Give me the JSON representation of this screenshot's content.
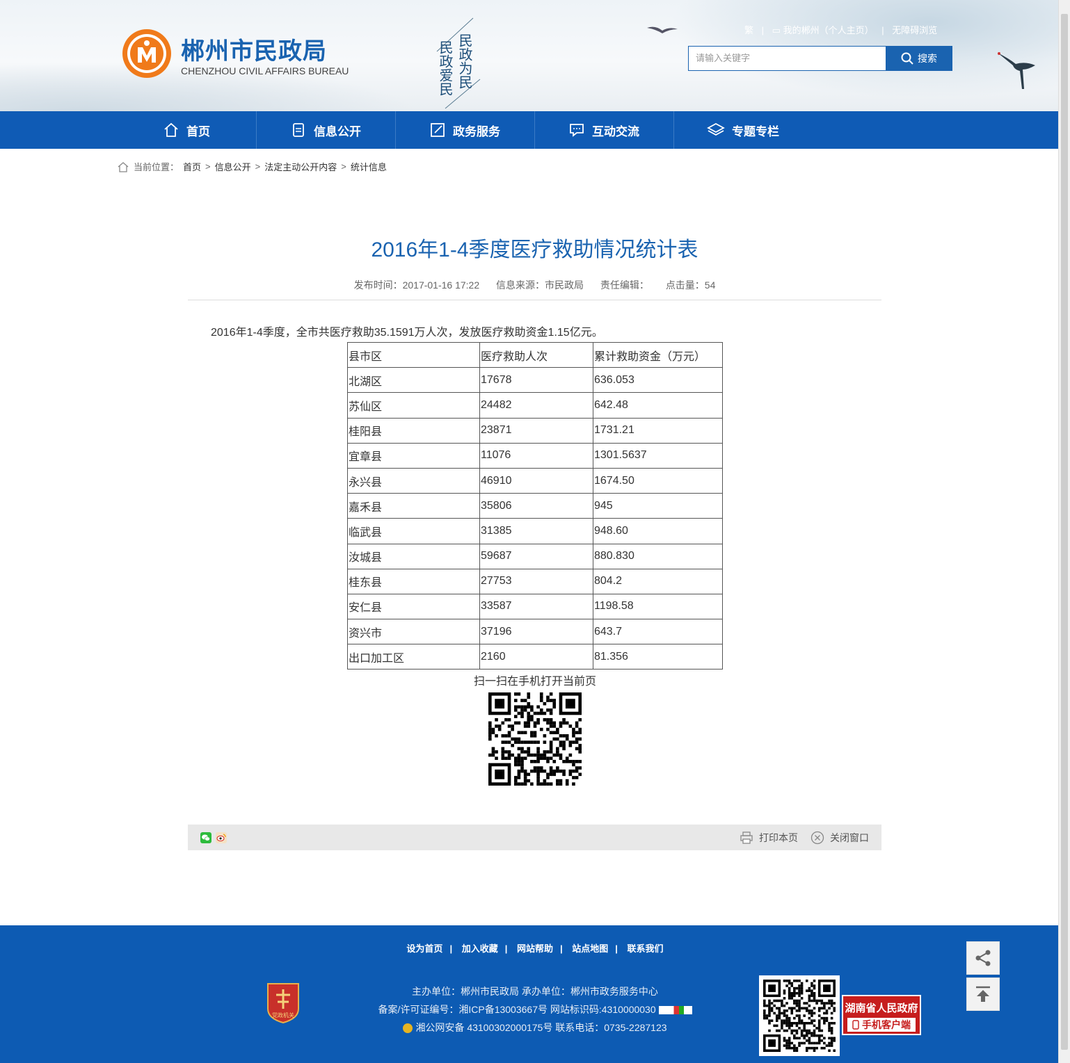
{
  "header": {
    "title": "郴州市民政局",
    "subtitle": "CHENZHOU CIVIL AFFAIRS BUREAU",
    "slogan_right": "民政为民",
    "slogan_left": "民政爱民",
    "top_links": [
      "繁",
      "我的郴州（个人主页）",
      "无障碍浏览"
    ],
    "search_placeholder": "请输入关键字",
    "search_button": "搜索"
  },
  "nav": {
    "items": [
      {
        "label": "首页",
        "icon": "home-icon"
      },
      {
        "label": "信息公开",
        "icon": "document-icon"
      },
      {
        "label": "政务服务",
        "icon": "edit-icon"
      },
      {
        "label": "互动交流",
        "icon": "chat-icon"
      },
      {
        "label": "专题专栏",
        "icon": "layers-icon"
      }
    ]
  },
  "breadcrumb": {
    "prefix": "当前位置：",
    "items": [
      "首页",
      "信息公开",
      "法定主动公开内容",
      "统计信息"
    ]
  },
  "article": {
    "title": "2016年1-4季度医疗救助情况统计表",
    "publish_time": "发布时间：2017-01-16 17:22",
    "source": "信息来源：市民政局",
    "editor": "责任编辑：",
    "hits": "点击量：54",
    "intro": "2016年1-4季度，全市共医疗救助35.1591万人次，发放医疗救助资金1.15亿元。",
    "table": {
      "headers": [
        "县市区",
        "医疗救助人次",
        "累计救助资金（万元）"
      ],
      "rows": [
        [
          "北湖区",
          "17678",
          "636.053"
        ],
        [
          "苏仙区",
          "24482",
          "642.48"
        ],
        [
          "桂阳县",
          "23871",
          "1731.21"
        ],
        [
          "宜章县",
          "11076",
          "1301.5637"
        ],
        [
          "永兴县",
          "46910",
          "1674.50"
        ],
        [
          "嘉禾县",
          "35806",
          "945"
        ],
        [
          "临武县",
          "31385",
          "948.60"
        ],
        [
          "汝城县",
          "59687",
          "880.830"
        ],
        [
          "桂东县",
          "27753",
          "804.2"
        ],
        [
          "安仁县",
          "33587",
          "1198.58"
        ],
        [
          "资兴市",
          "37196",
          "643.7"
        ],
        [
          "出口加工区",
          "2160",
          "81.356"
        ]
      ]
    },
    "scan_label": "扫一扫在手机打开当前页"
  },
  "share_bar": {
    "print": "打印本页",
    "close": "关闭窗口"
  },
  "footer": {
    "links": [
      "设为首页",
      "加入收藏",
      "网站帮助",
      "站点地图",
      "联系我们"
    ],
    "line1": "主办单位：郴州市民政局   承办单位：郴州市政务服务中心",
    "line2": "备案/许可证编号：湘ICP备13003667号    网站标识码:4310000030",
    "line3": "湘公网安备 43100302000175号   联系电话：0735-2287123",
    "app_title": "湖南省人民政府",
    "app_sub": "手机客户端",
    "emblem_text": "党政机关"
  },
  "colors": {
    "brand_blue": "#0f5bb5",
    "title_blue": "#1a63b0",
    "footer_blue": "#0d5bb3",
    "app_red": "#c61d1d"
  }
}
